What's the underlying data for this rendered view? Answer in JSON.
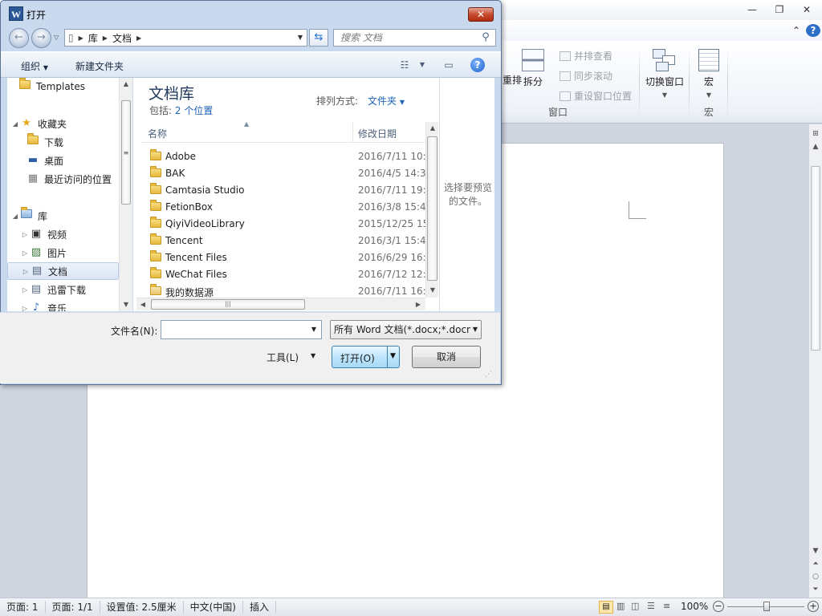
{
  "dialog": {
    "title": "打开",
    "app_icon_letter": "W",
    "address": [
      "库",
      "文档"
    ],
    "search_placeholder": "搜索 文档",
    "toolbar": {
      "organize_label": "组织",
      "new_folder_label": "新建文件夹"
    },
    "nav": {
      "templates_label": "Templates",
      "favorites_label": "收藏夹",
      "downloads_label": "下载",
      "desktop_label": "桌面",
      "recent_label": "最近访问的位置",
      "libraries_label": "库",
      "videos_label": "视频",
      "pictures_label": "图片",
      "documents_label": "文档",
      "thunder_label": "迅雷下载",
      "music_label": "音乐"
    },
    "library": {
      "title": "文档库",
      "includes_prefix": "包括:",
      "includes_link": "2 个位置",
      "sort_label": "排列方式:",
      "sort_value": "文件夹"
    },
    "columns": {
      "name": "名称",
      "date": "修改日期"
    },
    "files": [
      {
        "name": "Adobe",
        "date": "2016/7/11 10:2"
      },
      {
        "name": "BAK",
        "date": "2016/4/5 14:34"
      },
      {
        "name": "Camtasia Studio",
        "date": "2016/7/11 19:3"
      },
      {
        "name": "FetionBox",
        "date": "2016/3/8 15:43"
      },
      {
        "name": "QiyiVideoLibrary",
        "date": "2015/12/25 15"
      },
      {
        "name": "Tencent",
        "date": "2016/3/1 15:44"
      },
      {
        "name": "Tencent Files",
        "date": "2016/6/29 16:3"
      },
      {
        "name": "WeChat Files",
        "date": "2016/7/12 12:0"
      },
      {
        "name": "我的数据源",
        "date": "2016/7/11 16:3"
      }
    ],
    "preview_message": "选择要预览的文件。",
    "filename_label": "文件名(N):",
    "filename_value": "",
    "filter_value": "所有 Word 文档(*.docx;*.docm",
    "tools_label": "工具(L)",
    "open_label": "打开(O)",
    "cancel_label": "取消"
  },
  "ribbon": {
    "split_label": "拆分",
    "side_by_side_label": "并排查看",
    "sync_scroll_label": "同步滚动",
    "reset_window_label": "重设窗口位置",
    "switch_window_label": "切换窗口",
    "macros_label": "宏",
    "window_group_label": "窗口",
    "macros_group_label": "宏",
    "partial_label": "重排"
  },
  "status": {
    "page": "页面: 1",
    "pages": "页面: 1/1",
    "setting": "设置值: 2.5厘米",
    "language": "中文(中国)",
    "mode": "插入",
    "zoom": "100%"
  }
}
